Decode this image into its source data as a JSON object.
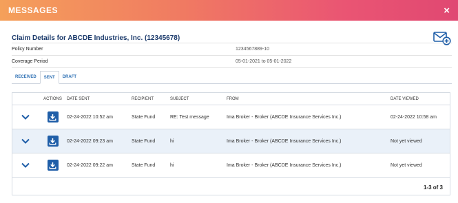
{
  "modal": {
    "title": "MESSAGES",
    "close_label": "×"
  },
  "claim": {
    "title": "Claim Details for ABCDE Industries, Inc. (12345678)"
  },
  "info": [
    {
      "label": "Policy Number",
      "value": "1234567889-10"
    },
    {
      "label": "Coverage Period",
      "value": "05-01-2021 to 05-01-2022"
    }
  ],
  "tabs": [
    {
      "label": "RECEIVED",
      "active": false
    },
    {
      "label": "SENT",
      "active": true
    },
    {
      "label": "DRAFT",
      "active": false
    }
  ],
  "grid": {
    "headers": {
      "actions": "ACTIONS",
      "date_sent": "DATE SENT",
      "recipient": "RECIPIENT",
      "subject": "SUBJECT",
      "from": "FROM",
      "date_viewed": "DATE VIEWED"
    },
    "rows": [
      {
        "date_sent": "02-24-2022 10:52 am",
        "recipient": "State Fund",
        "subject": "RE: Test message",
        "from": "Ima Broker - Broker (ABCDE Insurance Services Inc.)",
        "date_viewed": "02-24-2022 10:58 am"
      },
      {
        "date_sent": "02-24-2022 09:23 am",
        "recipient": "State Fund",
        "subject": "hi",
        "from": "Ima Broker - Broker (ABCDE Insurance Services Inc.)",
        "date_viewed": "Not yet viewed"
      },
      {
        "date_sent": "02-24-2022 09:22 am",
        "recipient": "State Fund",
        "subject": "hi",
        "from": "Ima Broker - Broker (ABCDE Insurance Services Inc.)",
        "date_viewed": "Not yet viewed"
      }
    ]
  },
  "pagination": {
    "text": "1-3 of 3"
  },
  "icons": {
    "close": "close-icon",
    "compose": "compose-mail-icon",
    "expand": "chevron-down-icon",
    "download": "download-icon"
  },
  "colors": {
    "header_gradient_start": "#f5a05a",
    "header_gradient_end": "#e04872",
    "primary_blue": "#1f5ea8",
    "title_navy": "#1b3a6b",
    "alt_row": "#eaf1f9"
  }
}
